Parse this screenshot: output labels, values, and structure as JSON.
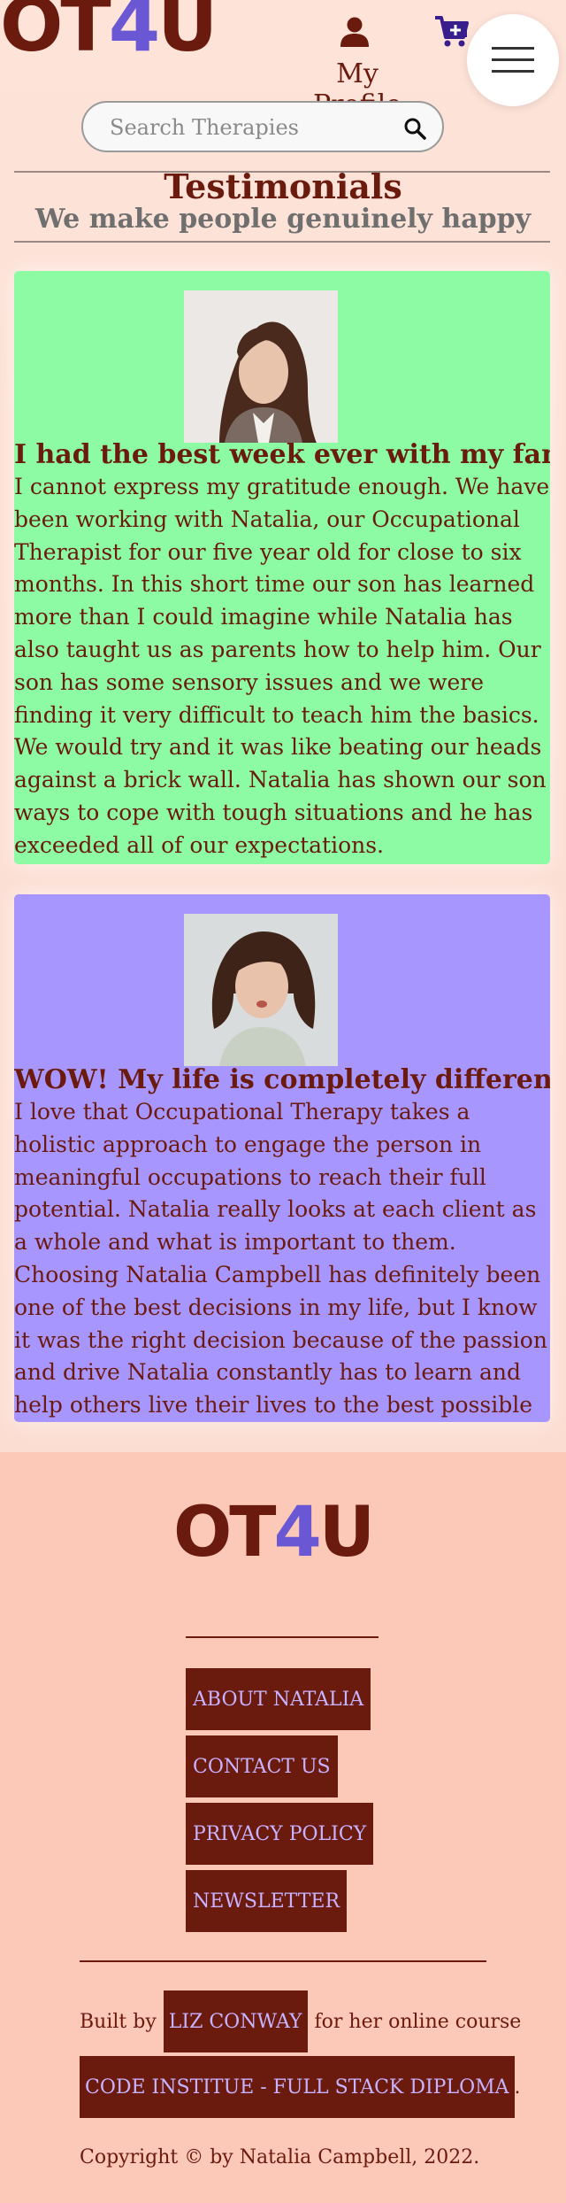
{
  "header": {
    "logo_text_1": "OT",
    "logo_text_2": "4",
    "logo_text_3": "U",
    "profile_label": "My Profile",
    "user_icon": "user-icon",
    "cart_icon": "cart-icon",
    "menu_icon": "hamburger-menu-icon"
  },
  "search": {
    "placeholder": "Search Therapies",
    "value": "",
    "icon": "search-icon"
  },
  "section": {
    "title": "Testimonials",
    "subtitle": "We make people genuinely happy"
  },
  "testimonials": [
    {
      "title": "I had the best week ever with my family",
      "body": "I cannot express my gratitude enough. We have been working with Natalia, our Occupational Therapist for our five year old for close to six months. In this short time our son has learned more than I could imagine while Natalia has also taught us as parents how to help him. Our son has some sensory issues and we were finding it very difficult to teach him the basics. We would try and it was like beating our heads against a brick wall. Natalia has shown our son ways to cope with tough situations and he has exceeded all of our expectations.",
      "background": "#8cfba3"
    },
    {
      "title": "WOW! My life is completely different now",
      "body": "I love that Occupational Therapy takes a holistic approach to engage the person in meaningful occupations to reach their full potential. Natalia really looks at each client as a whole and what is important to them. Choosing Natalia Campbell has definitely been one of the best decisions in my life, but I know it was the right decision because of the passion and drive Natalia constantly has to learn and help others live their lives to the best possible level.",
      "background": "#a896ff"
    }
  ],
  "footer": {
    "logo_text_1": "OT",
    "logo_text_2": "4",
    "logo_text_3": "U",
    "links": [
      "ABOUT NATALIA",
      "CONTACT US",
      "PRIVACY POLICY",
      "NEWSLETTER"
    ],
    "built_prefix": "Built by",
    "built_author": "LIZ CONWAY",
    "built_suffix": "for her online course",
    "course_link": "CODE INSTITUE - FULL STACK DIPLOMA",
    "course_suffix": ".",
    "copyright": "Copyright © by Natalia Campbell, 2022."
  },
  "colors": {
    "brand": "#6b1a0e",
    "accent_purple": "#6a57d4",
    "accent_green": "#8fe8b0",
    "page_bg": "#fde3d8",
    "footer_bg": "#fcc8b8",
    "link_text": "#c8b3ff"
  }
}
